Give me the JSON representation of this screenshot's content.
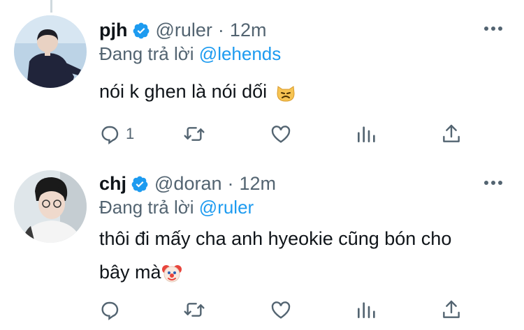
{
  "tweets": [
    {
      "display_name": "pjh",
      "handle": "@ruler",
      "separator": "·",
      "time": "12m",
      "reply_prefix": "Đang trả lời",
      "reply_to": "@lehends",
      "text": "nói k ghen là nói dối",
      "emoji": "grumpy-cat-face",
      "reply_count": "1"
    },
    {
      "display_name": "chj",
      "handle": "@doran",
      "separator": "·",
      "time": "12m",
      "reply_prefix": "Đang trả lời",
      "reply_to": "@ruler",
      "text_line1": "thôi đi mấy cha anh hyeokie cũng bón cho",
      "text_line2": "bây mà",
      "emoji": "clown-face",
      "reply_count": ""
    }
  ],
  "icons": {
    "verified": "verified-badge-icon",
    "reply": "reply-icon",
    "retweet": "retweet-icon",
    "like": "heart-icon",
    "analytics": "analytics-icon",
    "share": "share-icon",
    "more": "more-icon"
  },
  "colors": {
    "accent": "#1d9bf0",
    "secondary_text": "#536471",
    "primary_text": "#0f1419"
  }
}
